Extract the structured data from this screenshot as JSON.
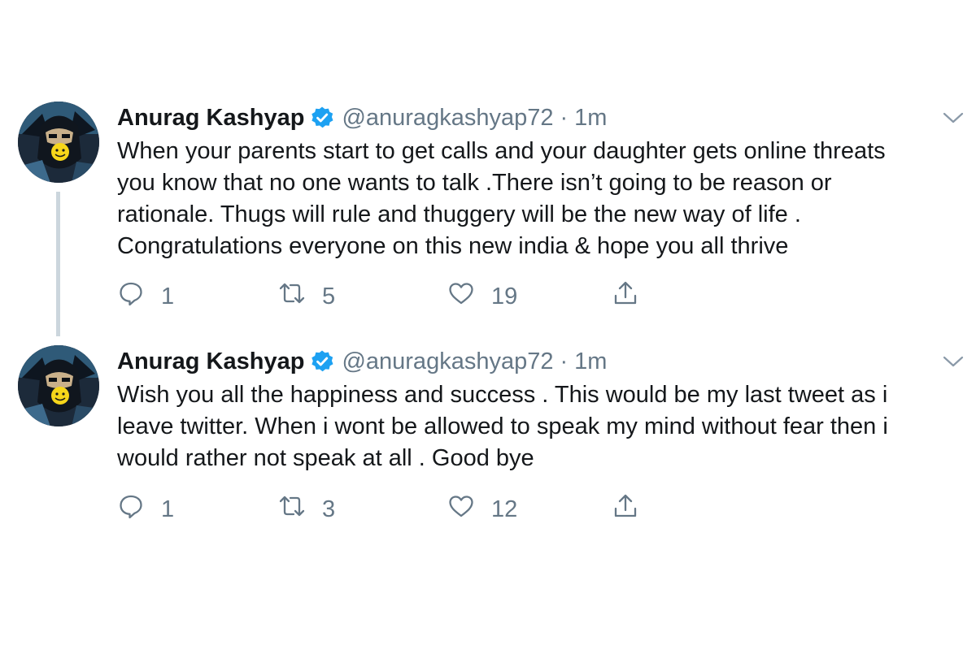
{
  "colors": {
    "text": "#14171a",
    "muted": "#657786",
    "verified": "#1da1f2",
    "thread_line": "#ccd6dd"
  },
  "tweets": [
    {
      "author_name": "Anurag Kashyap",
      "handle": "@anuragkashyap72",
      "separator": "·",
      "time": "1m",
      "lines": [
        "When your parents start to get calls and your daughter gets online threats",
        "you know that no one wants to talk .There isn’t going to be reason or",
        "rationale. Thugs will rule and thuggery will be the new way of life .",
        "Congratulations everyone on this new india & hope you all thrive"
      ],
      "reply_count": "1",
      "retweet_count": "5",
      "like_count": "19"
    },
    {
      "author_name": "Anurag Kashyap",
      "handle": "@anuragkashyap72",
      "separator": "·",
      "time": "1m",
      "lines": [
        "Wish you all the happiness and success . This would be my last tweet as i",
        "leave twitter. When i wont be allowed to speak my mind without fear then i",
        "would rather not speak at all . Good bye"
      ],
      "reply_count": "1",
      "retweet_count": "3",
      "like_count": "12"
    }
  ],
  "icons": {
    "verified": "verified-badge-icon",
    "caret": "chevron-down-icon",
    "reply": "reply-icon",
    "retweet": "retweet-icon",
    "like": "heart-icon",
    "share": "share-icon"
  }
}
